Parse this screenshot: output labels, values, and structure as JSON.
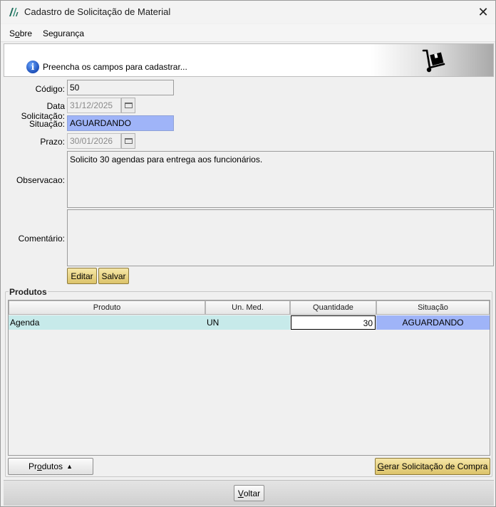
{
  "window": {
    "title": "Cadastro de Solicitação de Material",
    "close_glyph": "✕"
  },
  "menu": {
    "items": [
      {
        "prefix": "S",
        "accel": "o",
        "rest": "bre"
      },
      {
        "label": "Segurança"
      }
    ]
  },
  "banner": {
    "text": "Preencha os campos para cadastrar...",
    "info_glyph": "i",
    "icon": "hand-truck-icon"
  },
  "form": {
    "codigo_label": "Código:",
    "codigo_value": "50",
    "data_label": "Data Solicitação:",
    "data_value": "31/12/2025",
    "situacao_label": "Situação:",
    "situacao_value": "AGUARDANDO",
    "prazo_label": "Prazo:",
    "prazo_value": "30/01/2026",
    "observacao_label": "Observacao:",
    "observacao_value": "Solicito 30 agendas para entrega aos funcionários.",
    "comentario_label": "Comentário:",
    "comentario_value": "",
    "editar_label": "Editar",
    "salvar_label": "Salvar"
  },
  "produtos": {
    "group_title": "Produtos",
    "columns": [
      "Produto",
      "Un. Med.",
      "Quantidade",
      "Situação"
    ],
    "rows": [
      {
        "produto": "Agenda",
        "unidade": "UN",
        "quantidade": "30",
        "situacao": "AGUARDANDO"
      }
    ],
    "produtos_button": {
      "prefix": "Pr",
      "accel": "o",
      "rest": "dutos",
      "arrow": "▲"
    },
    "gerar_button": {
      "accel": "G",
      "rest": "erar Solicitação de Compra"
    }
  },
  "footer": {
    "voltar_button": {
      "accel": "V",
      "rest": "oltar"
    }
  },
  "colors": {
    "status_blue": "#9fb4f8",
    "row_cyan": "#c7eaea",
    "gold_button": "#dcc36a"
  }
}
